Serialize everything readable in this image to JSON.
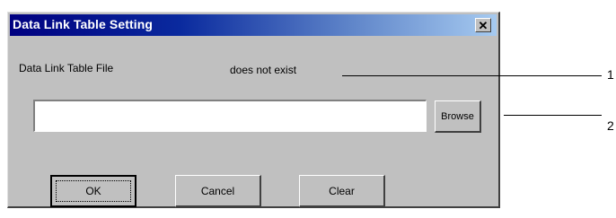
{
  "dialog": {
    "title": "Data Link Table Setting",
    "close_label": "✕",
    "file_label": "Data Link Table File",
    "status_text": "does not exist",
    "path_input": {
      "value": "",
      "placeholder": ""
    },
    "buttons": {
      "browse": "Browse",
      "ok": "OK",
      "cancel": "Cancel",
      "clear": "Clear"
    }
  },
  "callouts": [
    "1",
    "2"
  ],
  "colors": {
    "window_bg": "#c0c0c0",
    "title_start": "#000080",
    "title_end": "#a6caf0"
  }
}
